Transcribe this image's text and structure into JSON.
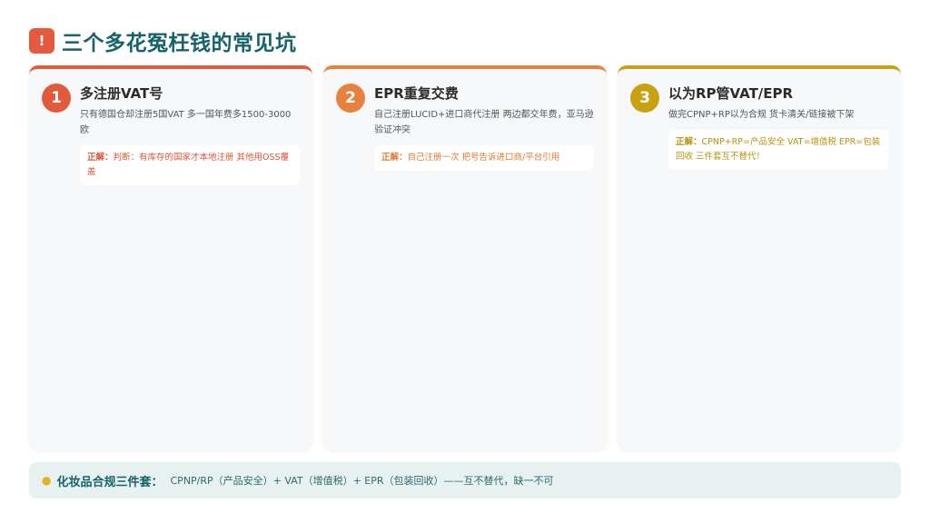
{
  "header": {
    "badge": "!",
    "title": "三个多花冤枉钱的常见坑"
  },
  "cards": [
    {
      "number": "1",
      "title": "多注册VAT号",
      "desc": "只有德国仓却注册5国VAT 多一国年费多1500-3000欧",
      "tip_key": "正解：",
      "tip_text": "判断：有库存的国家才本地注册 其他用OSS覆盖"
    },
    {
      "number": "2",
      "title": "EPR重复交费",
      "desc": "自己注册LUCID+进口商代注册 两边都交年费，亚马逊验证冲突",
      "tip_key": "正解：",
      "tip_text": "自己注册一次 把号告诉进口商/平台引用"
    },
    {
      "number": "3",
      "title": "以为RP管VAT/EPR",
      "desc": "做完CPNP+RP以为合规 货卡清关/链接被下架",
      "tip_key": "正解：",
      "tip_text": "CPNP+RP=产品安全 VAT=增值税 EPR=包装回收 三件套互不替代！"
    }
  ],
  "footer": {
    "icon": "bulb-icon",
    "label": "化妆品合规三件套：",
    "text": "CPNP/RP（产品安全）+ VAT（增值税）+ EPR（包装回收）——互不替代，缺一不可"
  },
  "colors": {
    "title": "#17636a",
    "card1": "#e05a3c",
    "card2": "#e8813e",
    "card3": "#c9a113"
  }
}
